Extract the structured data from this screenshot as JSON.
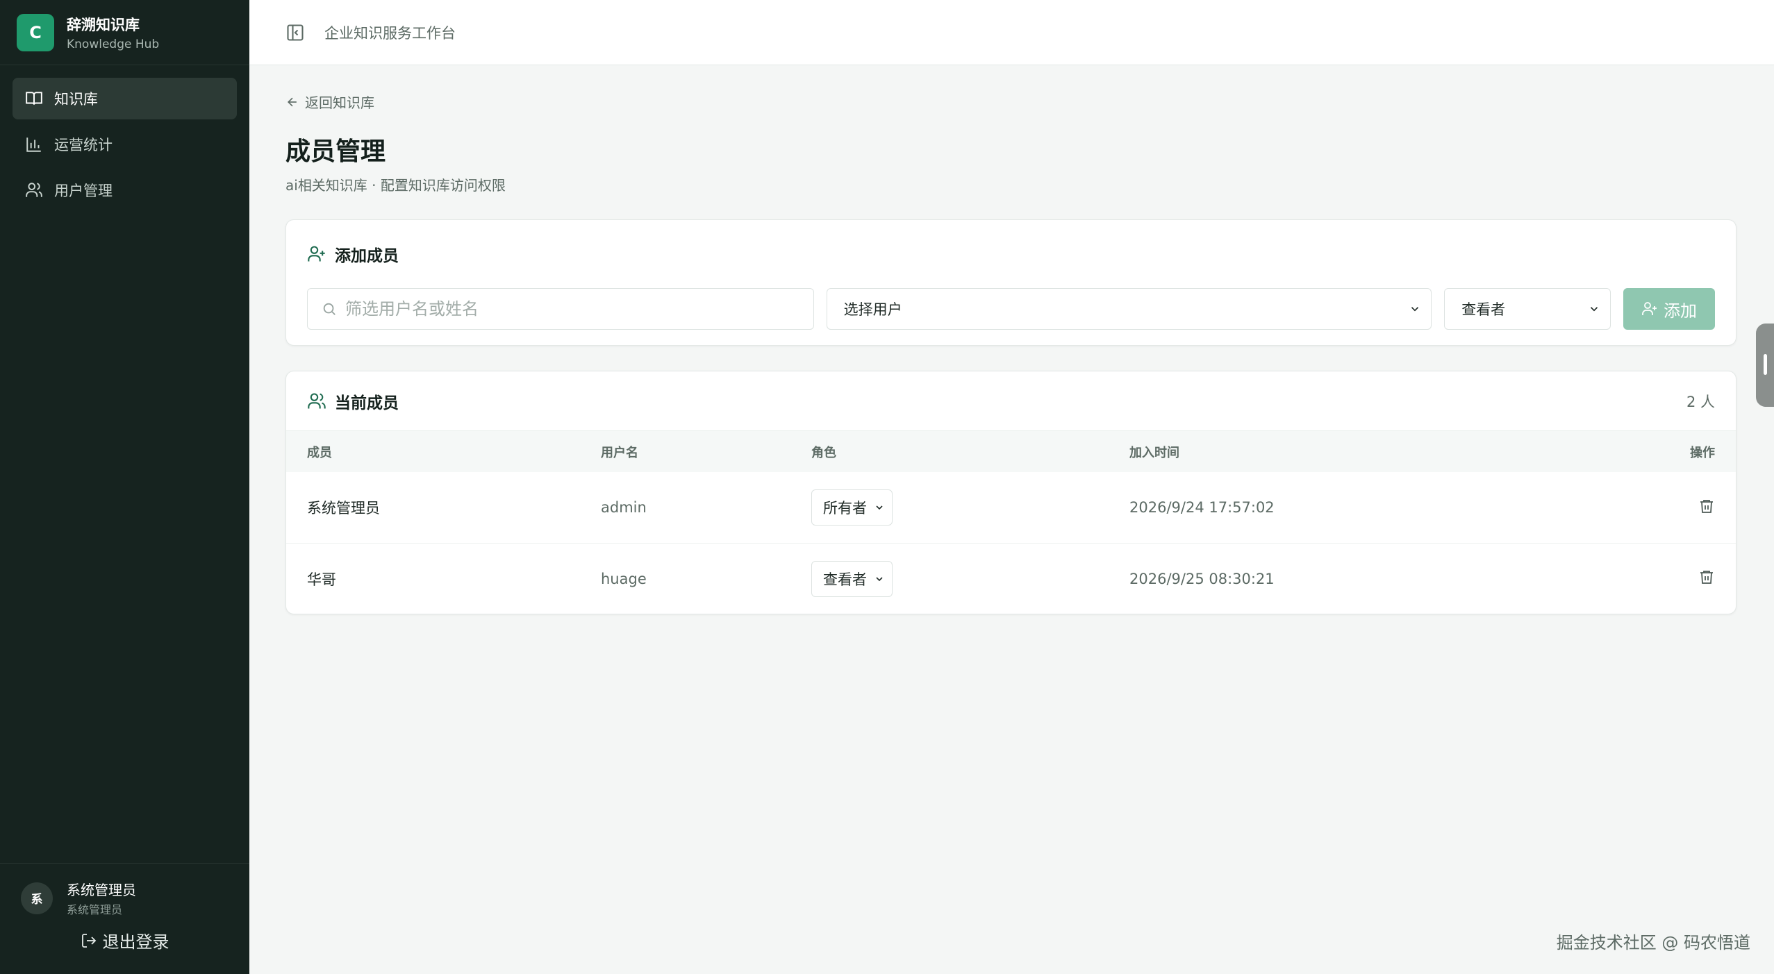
{
  "brand": {
    "logo_letter": "C",
    "title": "辞溯知识库",
    "subtitle": "Knowledge Hub"
  },
  "nav": {
    "items": [
      {
        "label": "知识库",
        "icon": "book-icon",
        "active": true
      },
      {
        "label": "运营统计",
        "icon": "bar-chart-icon",
        "active": false
      },
      {
        "label": "用户管理",
        "icon": "users-icon",
        "active": false
      }
    ]
  },
  "user": {
    "avatar": "系",
    "name": "系统管理员",
    "role": "系统管理员",
    "logout_label": "退出登录"
  },
  "topbar": {
    "title": "企业知识服务工作台"
  },
  "page": {
    "back_label": "返回知识库",
    "title": "成员管理",
    "subtitle": "ai相关知识库 · 配置知识库访问权限"
  },
  "add_member": {
    "title": "添加成员",
    "search_placeholder": "筛选用户名或姓名",
    "select_user": "选择用户",
    "select_role": "查看者",
    "add_label": "添加"
  },
  "members": {
    "title": "当前成员",
    "count": "2 人",
    "columns": {
      "member": "成员",
      "username": "用户名",
      "role": "角色",
      "joined": "加入时间",
      "action": "操作"
    },
    "rows": [
      {
        "member": "系统管理员",
        "username": "admin",
        "role": "所有者",
        "joined": "2026/9/24 17:57:02"
      },
      {
        "member": "华哥",
        "username": "huage",
        "role": "查看者",
        "joined": "2026/9/25 08:30:21"
      }
    ]
  },
  "watermark": "掘金技术社区 @ 码农悟道",
  "colors": {
    "sidebar": "#16231f",
    "accent": "#1f9a6c",
    "button": "#8fc7b0"
  }
}
